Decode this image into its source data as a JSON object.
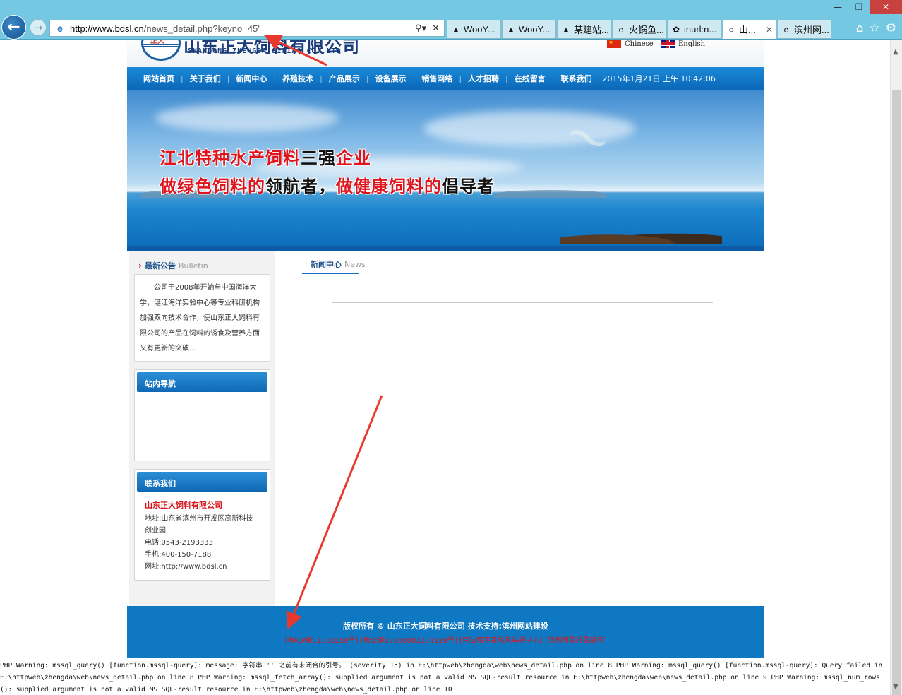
{
  "browser": {
    "url_host": "http://www.bdsl.cn",
    "url_rest": "/news_detail.php?keyno=45'",
    "tabs": [
      {
        "label": "WooY...",
        "icon": "wooyun-icon",
        "active": false
      },
      {
        "label": "WooY...",
        "icon": "wooyun-icon",
        "active": false
      },
      {
        "label": "某建站...",
        "icon": "wooyun-icon",
        "active": false
      },
      {
        "label": "火锅鱼...",
        "icon": "ie-icon",
        "active": false
      },
      {
        "label": "inurl:n...",
        "icon": "paw-icon",
        "active": false
      },
      {
        "label": "山...",
        "icon": "loading-icon",
        "active": true
      },
      {
        "label": "滨州网...",
        "icon": "ie-icon",
        "active": false
      }
    ]
  },
  "site": {
    "logo_cn": "山东正大饲料有限公司",
    "logo_en": "SHANDONG ZHENGDA SILIAO CO.,LTD",
    "lang_cn": "Chinese",
    "lang_en": "English",
    "nav": [
      "网站首页",
      "关于我们",
      "新闻中心",
      "养殖技术",
      "产品展示",
      "设备展示",
      "销售网络",
      "人才招聘",
      "在线留言",
      "联系我们"
    ],
    "datetime": "2015年1月21日 上午 10:42:06",
    "slogan1": [
      {
        "t": "江北特种水产饲料",
        "c": "red"
      },
      {
        "t": "三强",
        "c": "blk"
      },
      {
        "t": "企业",
        "c": "red"
      }
    ],
    "slogan2": [
      {
        "t": "做绿色饲料的",
        "c": "red"
      },
      {
        "t": "领航者，",
        "c": "blk"
      },
      {
        "t": "做健康饲料的",
        "c": "red"
      },
      {
        "t": "倡导者",
        "c": "blk"
      }
    ],
    "bulletin_title": "最新公告",
    "bulletin_en": "Bulletin",
    "bulletin_text": "公司于2008年开始与中国海洋大学，湛江海洋实验中心等专业科研机构加强双向技术合作，使山东正大饲料有限公司的产品在饲料的诱食及营养方面又有更新的突破...",
    "site_nav_title": "站内导航",
    "contact_title": "联系我们",
    "contact": {
      "company": "山东正大饲料有限公司",
      "address": "地址:山东省滨州市开发区高新科技创业园",
      "phone": "电话:0543-2193333",
      "mobile": "手机:400-150-7188",
      "website": "网址:http://www.bdsl.cn"
    },
    "news_title": "新闻中心",
    "news_en": "News",
    "footer_copy": "版权所有 © 山东正大饲料有限公司 技术支持:滨州网站建设",
    "footer_links": "[鲁ICP备11000159号] [鲁公备37160001224119号] [违法和不良信息举报中心] [滨州网警报警邮箱]"
  },
  "php_warning": "PHP Warning: mssql_query() [function.mssql-query]: message: 字符串 '' 之前有未闭合的引号。 (severity 15) in E:\\httpweb\\zhengda\\web\\news_detail.php on line 8 PHP Warning: mssql_query() [function.mssql-query]: Query failed in E:\\httpweb\\zhengda\\web\\news_detail.php on line 8 PHP Warning: mssql_fetch_array(): supplied argument is not a valid MS SQL-result resource in E:\\httpweb\\zhengda\\web\\news_detail.php on line 9 PHP Warning: mssql_num_rows(): supplied argument is not a valid MS SQL-result resource in E:\\httpweb\\zhengda\\web\\news_detail.php on line 10",
  "colors": {
    "nav_blue": "#0b67b8",
    "slogan_red": "#e0141c",
    "footer_blue": "#0e79c2",
    "annotation_red": "#e8392e"
  }
}
